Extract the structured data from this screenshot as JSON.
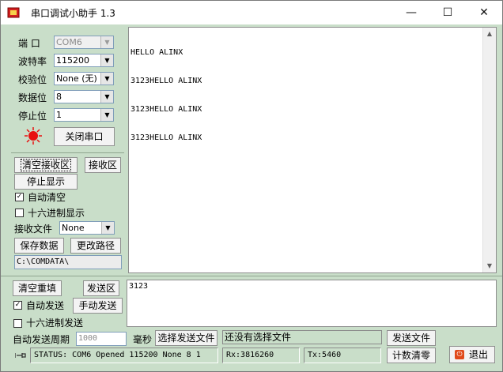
{
  "window": {
    "title": "串口调试小助手 1.3",
    "controls": {
      "minimize": "—",
      "maximize": "☐",
      "close": "✕"
    }
  },
  "port_settings": {
    "port_label": "端  口",
    "port_value": "COM6",
    "baud_label": "波特率",
    "baud_value": "115200",
    "parity_label": "校验位",
    "parity_value": "None (无)",
    "databits_label": "数据位",
    "databits_value": "8",
    "stopbits_label": "停止位",
    "stopbits_value": "1",
    "close_port_button": "关闭串口",
    "indicator_color": "#e81010"
  },
  "receive_controls": {
    "clear_rx_button": "清空接收区",
    "rx_area_label": "接收区",
    "stop_display_button": "停止显示",
    "auto_clear_label": "自动清空",
    "auto_clear_checked": true,
    "hex_display_label": "十六进制显示",
    "hex_display_checked": false,
    "rx_file_label": "接收文件",
    "rx_file_value": "None",
    "save_data_button": "保存数据",
    "change_path_button": "更改路径",
    "path_value": "C:\\COMDATA\\"
  },
  "receive_area": {
    "lines": [
      "HELLO ALINX",
      "3123HELLO ALINX",
      "3123HELLO ALINX",
      "3123HELLO ALINX"
    ]
  },
  "send_controls": {
    "clear_resend_button": "清空重填",
    "tx_area_label": "发送区",
    "auto_send_label": "自动发送",
    "auto_send_checked": true,
    "manual_send_button": "手动发送",
    "hex_send_label": "十六进制发送",
    "hex_send_checked": false,
    "period_label": "自动发送周期",
    "period_value": "1000",
    "ms_label": "毫秒",
    "select_file_button": "选择发送文件",
    "file_status": "还没有选择文件",
    "send_file_button": "发送文件",
    "count_clear_button": "计数清零",
    "exit_button": "退出"
  },
  "send_area": {
    "text": "3123"
  },
  "status_bar": {
    "status": "STATUS: COM6 Opened 115200 None  8 1",
    "rx": "Rx:3816260",
    "tx": "Tx:5460"
  }
}
